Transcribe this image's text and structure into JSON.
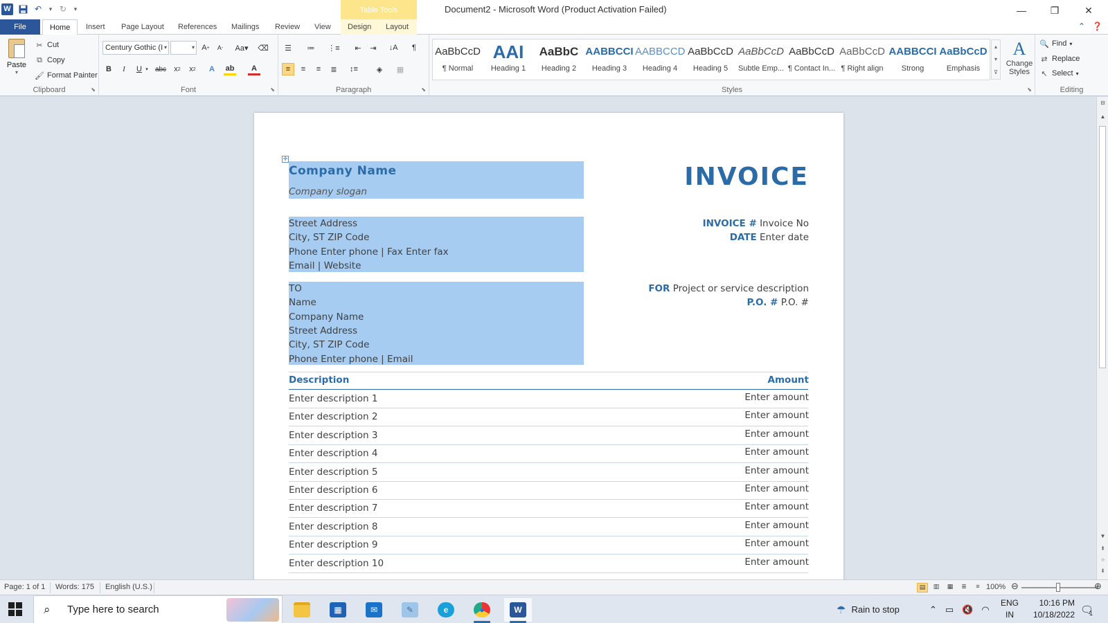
{
  "titlebar": {
    "doc_title": "Document2 - Microsoft Word (Product Activation Failed)",
    "table_tools": "Table Tools",
    "minimize": "—",
    "restore": "❐",
    "close": "✕"
  },
  "tabs": {
    "file": "File",
    "home": "Home",
    "insert": "Insert",
    "page_layout": "Page Layout",
    "references": "References",
    "mailings": "Mailings",
    "review": "Review",
    "view": "View",
    "design": "Design",
    "layout": "Layout"
  },
  "clipboard": {
    "paste": "Paste",
    "cut": "Cut",
    "copy": "Copy",
    "format_painter": "Format Painter",
    "label": "Clipboard"
  },
  "font": {
    "font_name": "Century Gothic (I",
    "font_size": "",
    "label": "Font"
  },
  "paragraph": {
    "label": "Paragraph"
  },
  "styles": {
    "label": "Styles",
    "change_styles": "Change Styles",
    "items": [
      {
        "sample": "AaBbCcD",
        "name": "¶ Normal"
      },
      {
        "sample": "AAI",
        "name": "Heading 1"
      },
      {
        "sample": "AaBbC",
        "name": "Heading 2"
      },
      {
        "sample": "AABBCCI",
        "name": "Heading 3"
      },
      {
        "sample": "AABBCCD",
        "name": "Heading 4"
      },
      {
        "sample": "AaBbCcD",
        "name": "Heading 5"
      },
      {
        "sample": "AaBbCcD",
        "name": "Subtle Emp..."
      },
      {
        "sample": "AaBbCcD",
        "name": "¶ Contact In..."
      },
      {
        "sample": "AaBbCcD",
        "name": "¶ Right align"
      },
      {
        "sample": "AABBCCI",
        "name": "Strong"
      },
      {
        "sample": "AaBbCcD",
        "name": "Emphasis"
      }
    ]
  },
  "editing": {
    "find": "Find",
    "replace": "Replace",
    "select": "Select",
    "label": "Editing"
  },
  "document": {
    "company_name": "Company Name",
    "company_slogan": "Company slogan",
    "invoice_title": "INVOICE",
    "address": [
      "Street Address",
      "City, ST ZIP Code",
      "Phone Enter phone | Fax Enter fax",
      "Email | Website"
    ],
    "invoice_no_label": "INVOICE #",
    "invoice_no_value": "Invoice No",
    "date_label": "DATE",
    "date_value": "Enter date",
    "to_block": [
      "TO",
      "Name",
      "Company Name",
      "Street Address",
      "City, ST ZIP Code",
      "Phone Enter phone | Email"
    ],
    "for_label": "FOR",
    "for_value": "Project or service description",
    "po_label": "P.O. #",
    "po_value": "P.O. #",
    "table_header": {
      "description": "Description",
      "amount": "Amount"
    },
    "rows": [
      {
        "description": "Enter description 1",
        "amount": "Enter amount"
      },
      {
        "description": "Enter description 2",
        "amount": "Enter amount"
      },
      {
        "description": "Enter description 3",
        "amount": "Enter amount"
      },
      {
        "description": "Enter description 4",
        "amount": "Enter amount"
      },
      {
        "description": "Enter description 5",
        "amount": "Enter amount"
      },
      {
        "description": "Enter description 6",
        "amount": "Enter amount"
      },
      {
        "description": "Enter description 7",
        "amount": "Enter amount"
      },
      {
        "description": "Enter description 8",
        "amount": "Enter amount"
      },
      {
        "description": "Enter description 9",
        "amount": "Enter amount"
      },
      {
        "description": "Enter description 10",
        "amount": "Enter amount"
      }
    ]
  },
  "statusbar": {
    "page": "Page: 1 of 1",
    "words": "Words: 175",
    "language": "English (U.S.)",
    "zoom": "100%"
  },
  "taskbar": {
    "search_placeholder": "Type here to search",
    "weather": "Rain to stop",
    "lang_top": "ENG",
    "lang_bottom": "IN",
    "time": "10:16 PM",
    "date": "10/18/2022",
    "notifications": "1"
  },
  "colors": {
    "accent": "#2b579a",
    "heading_blue": "#2b6ca8",
    "selection": "#a6ccf2"
  }
}
